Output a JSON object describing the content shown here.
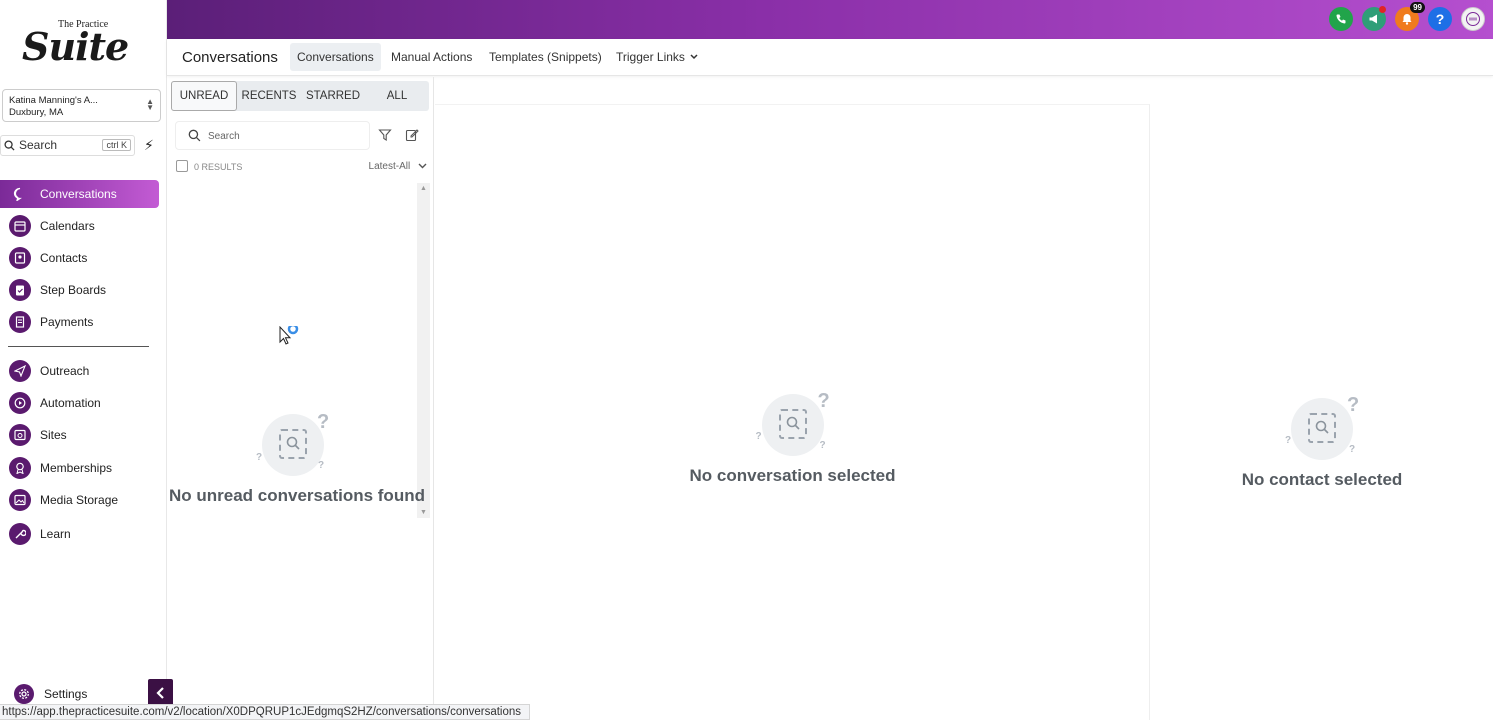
{
  "brand": {
    "logo_small": "The Practice",
    "logo_big": "Suite"
  },
  "location": {
    "name": "Katina Manning's A...",
    "city": "Duxbury, MA"
  },
  "sidebar_search": {
    "label": "Search",
    "shortcut": "ctrl K"
  },
  "nav": {
    "conversations": "Conversations",
    "calendars": "Calendars",
    "contacts": "Contacts",
    "step_boards": "Step Boards",
    "payments": "Payments",
    "outreach": "Outreach",
    "automation": "Automation",
    "sites": "Sites",
    "memberships": "Memberships",
    "media_storage": "Media Storage",
    "learn": "Learn",
    "settings": "Settings"
  },
  "topbar": {
    "notification_count": "99",
    "help": "?"
  },
  "header": {
    "title": "Conversations",
    "tabs": [
      "Conversations",
      "Manual Actions",
      "Templates (Snippets)",
      "Trigger Links"
    ]
  },
  "filter_tabs": [
    "UNREAD",
    "RECENTS",
    "STARRED",
    "ALL"
  ],
  "list": {
    "search_placeholder": "Search",
    "results": "0 RESULTS",
    "sort": "Latest-All",
    "empty": "No unread conversations found"
  },
  "middle": {
    "empty": "No conversation selected"
  },
  "right": {
    "empty": "No contact selected"
  },
  "status_url": "https://app.thepracticesuite.com/v2/location/X0DPQRUP1cJEdgmqS2HZ/conversations/conversations",
  "colors": {
    "brand_dark": "#5a1a6e",
    "brand_gradient_start": "#5b1f78",
    "brand_gradient_end": "#b54fcf"
  }
}
